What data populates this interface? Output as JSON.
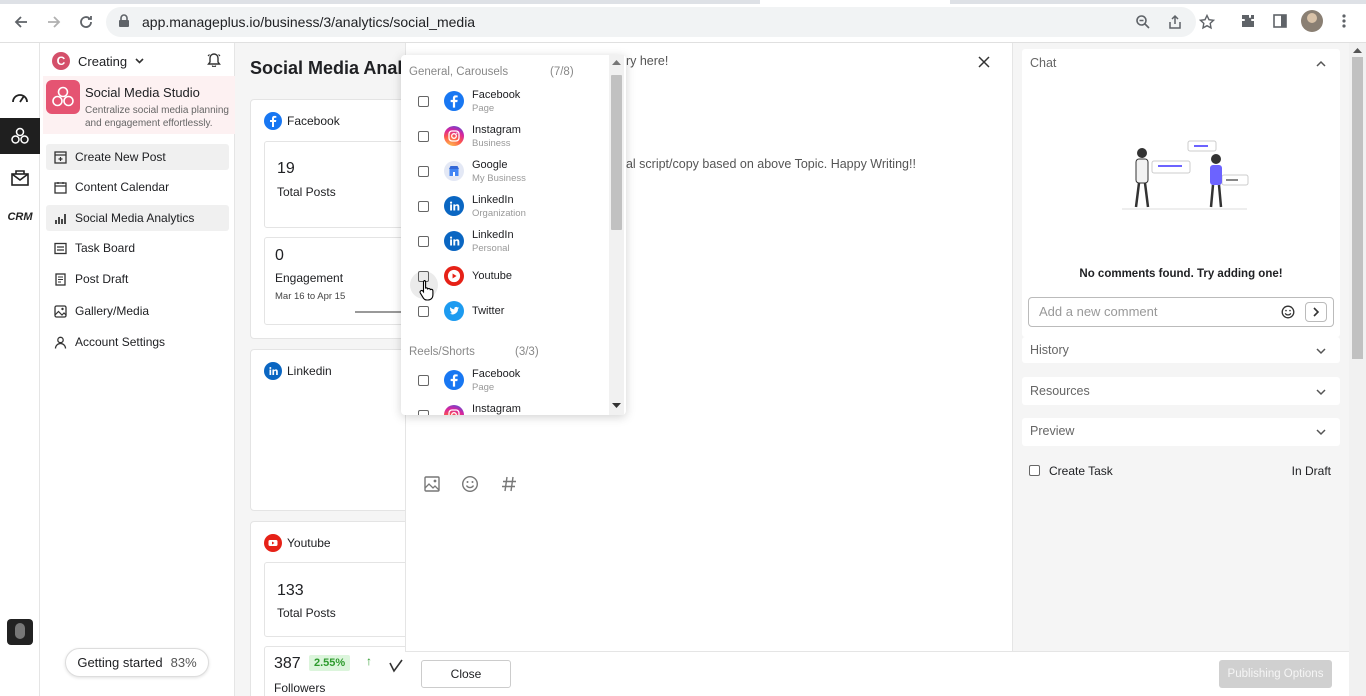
{
  "browser": {
    "url": "app.manageplus.io/business/3/analytics/social_media"
  },
  "workspace": {
    "badge": "C",
    "name": "Creating"
  },
  "studio": {
    "title": "Social Media Studio",
    "description": "Centralize social media planning and engagement effortlessly."
  },
  "menu": [
    {
      "label": "Create New Post"
    },
    {
      "label": "Content Calendar"
    },
    {
      "label": "Social Media Analytics"
    },
    {
      "label": "Task Board"
    },
    {
      "label": "Post Draft"
    },
    {
      "label": "Gallery/Media"
    },
    {
      "label": "Account Settings"
    }
  ],
  "getting_started": {
    "label": "Getting started",
    "percent": "83%"
  },
  "rail": {
    "crm_label": "CRM"
  },
  "analytics": {
    "title": "Social Media Anal",
    "facebook": {
      "name": "Facebook",
      "total_posts": "19",
      "total_posts_label": "Total Posts",
      "engagement": "0",
      "engagement_label": "Engagement",
      "range": "Mar 16 to Apr 15"
    },
    "linkedin": {
      "name": "Linkedin"
    },
    "youtube": {
      "name": "Youtube",
      "total_posts": "133",
      "total_posts_label": "Total Posts",
      "followers": "387",
      "growth": "2.55%",
      "followers_label": "Followers"
    }
  },
  "editor": {
    "hint_top": "ary here!",
    "hint_body": "nal script/copy based on above Topic. Happy Writing!!"
  },
  "dropdown": {
    "groups": [
      {
        "name": "General, Carousels",
        "count": "(7/8)"
      },
      {
        "name": "Reels/Shorts",
        "count": "(3/3)"
      }
    ],
    "options": [
      {
        "name": "Facebook",
        "sub": "Page"
      },
      {
        "name": "Instagram",
        "sub": "Business"
      },
      {
        "name": "Google",
        "sub": "My Business"
      },
      {
        "name": "LinkedIn",
        "sub": "Organization"
      },
      {
        "name": "LinkedIn",
        "sub": "Personal"
      },
      {
        "name": "Youtube",
        "sub": ""
      },
      {
        "name": "Twitter",
        "sub": ""
      },
      {
        "name": "Facebook",
        "sub": "Page"
      },
      {
        "name": "Instagram",
        "sub": ""
      }
    ]
  },
  "chat": {
    "title": "Chat",
    "empty": "No comments found. Try adding one!",
    "placeholder": "Add a new comment"
  },
  "sections": {
    "history": "History",
    "resources": "Resources",
    "preview": "Preview"
  },
  "task": {
    "label": "Create Task",
    "status": "In Draft"
  },
  "footer": {
    "close": "Close",
    "publish": "Publishing Options"
  },
  "colors": {
    "facebook": "#1877f2",
    "linkedin": "#0a66c2",
    "youtube": "#e62117",
    "twitter": "#1d9bf0",
    "brand": "#e55472",
    "growth": "#2e9b2e"
  }
}
